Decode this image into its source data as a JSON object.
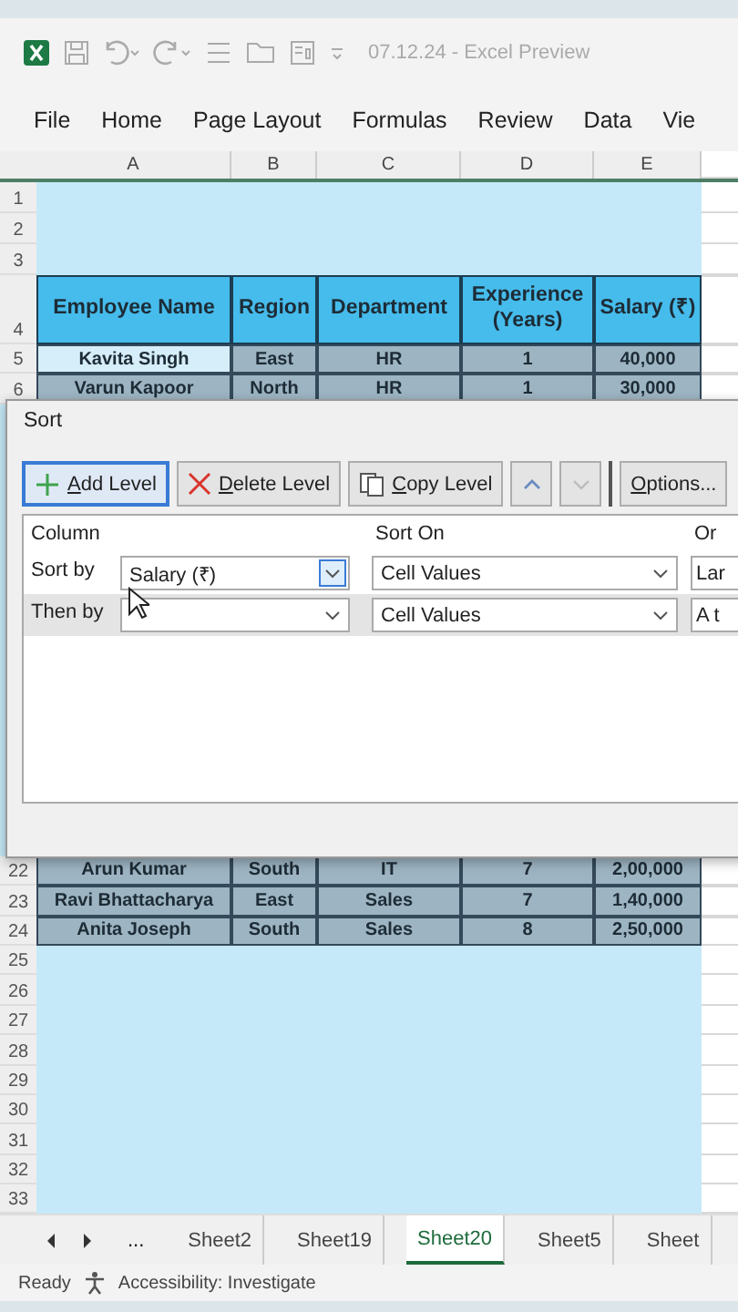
{
  "title_bar": {
    "document_title": "07.12.24  -  Excel Preview"
  },
  "ribbon_tabs": [
    {
      "label": "File"
    },
    {
      "label": "Home"
    },
    {
      "label": "Page Layout"
    },
    {
      "label": "Formulas"
    },
    {
      "label": "Review"
    },
    {
      "label": "Data"
    },
    {
      "label": "Vie"
    }
  ],
  "sheet": {
    "column_headers": [
      "A",
      "B",
      "C",
      "D",
      "E"
    ],
    "rows_top": [
      {
        "number": "1",
        "kind": "blank"
      },
      {
        "number": "2",
        "kind": "blank"
      },
      {
        "number": "3",
        "kind": "blank"
      },
      {
        "number": "4",
        "kind": "header",
        "cells": [
          {
            "text": "Employee Name"
          },
          {
            "text": "Region"
          },
          {
            "text": "Department"
          },
          {
            "text": "Experience (Years)"
          },
          {
            "text": "Salary (₹)"
          }
        ]
      },
      {
        "number": "5",
        "kind": "data",
        "cells": [
          {
            "text": "Kavita Singh",
            "selected": true
          },
          {
            "text": "East",
            "selected": false
          },
          {
            "text": "HR",
            "selected": false
          },
          {
            "text": "1",
            "selected": false
          },
          {
            "text": "40,000",
            "selected": false
          }
        ]
      },
      {
        "number": "6",
        "kind": "data",
        "cells": [
          {
            "text": "Varun Kapoor",
            "selected": false
          },
          {
            "text": "North",
            "selected": false
          },
          {
            "text": "HR",
            "selected": false
          },
          {
            "text": "1",
            "selected": false
          },
          {
            "text": "30,000",
            "selected": false
          }
        ]
      }
    ],
    "rows_bottom": [
      {
        "number": "22",
        "kind": "data",
        "cells": [
          {
            "text": "Arun Kumar",
            "selected": false
          },
          {
            "text": "South",
            "selected": false
          },
          {
            "text": "IT",
            "selected": false
          },
          {
            "text": "7",
            "selected": false
          },
          {
            "text": "2,00,000",
            "selected": false
          }
        ]
      },
      {
        "number": "23",
        "kind": "data",
        "cells": [
          {
            "text": "Ravi Bhattacharya",
            "selected": false
          },
          {
            "text": "East",
            "selected": false
          },
          {
            "text": "Sales",
            "selected": false
          },
          {
            "text": "7",
            "selected": false
          },
          {
            "text": "1,40,000",
            "selected": false
          }
        ]
      },
      {
        "number": "24",
        "kind": "data",
        "cells": [
          {
            "text": "Anita Joseph",
            "selected": false
          },
          {
            "text": "South",
            "selected": false
          },
          {
            "text": "Sales",
            "selected": false
          },
          {
            "text": "8",
            "selected": false
          },
          {
            "text": "2,50,000",
            "selected": false
          }
        ]
      },
      {
        "number": "25",
        "kind": "blank"
      },
      {
        "number": "26",
        "kind": "blank"
      },
      {
        "number": "27",
        "kind": "blank"
      },
      {
        "number": "28",
        "kind": "blank"
      },
      {
        "number": "29",
        "kind": "blank"
      },
      {
        "number": "30",
        "kind": "blank"
      },
      {
        "number": "31",
        "kind": "blank"
      },
      {
        "number": "32",
        "kind": "blank"
      },
      {
        "number": "33",
        "kind": "blank"
      }
    ]
  },
  "sort_dialog": {
    "title": "Sort",
    "toolbar": [
      {
        "kind": "add",
        "mnemonic": "A",
        "rest": "dd Level",
        "focused": true
      },
      {
        "kind": "delete",
        "mnemonic": "D",
        "rest": "elete Level",
        "focused": false
      },
      {
        "kind": "copy",
        "mnemonic": "C",
        "rest": "opy Level",
        "focused": false
      },
      {
        "kind": "up",
        "focused": false
      },
      {
        "kind": "down",
        "focused": false
      },
      {
        "kind": "options",
        "mnemonic": "O",
        "rest": "ptions...",
        "focused": false
      }
    ],
    "headers": {
      "column": "Column",
      "sort_on": "Sort On",
      "order": "Or"
    },
    "levels": [
      {
        "label": "Sort by",
        "column": "Salary (₹)",
        "column_focused": true,
        "sort_on": "Cell Values",
        "order": "Lar",
        "selected": false
      },
      {
        "label": "Then by",
        "column_focused": false,
        "sort_on": "Cell Values",
        "order": "A t",
        "selected": true
      }
    ]
  },
  "sheet_tabs": {
    "more": "...",
    "tabs": [
      {
        "label": "Sheet2",
        "selected": false
      },
      {
        "label": "Sheet19",
        "selected": false
      },
      {
        "label": "Sheet20",
        "selected": true
      },
      {
        "label": "Sheet5",
        "selected": false
      },
      {
        "label": "Sheet",
        "selected": false
      }
    ]
  },
  "status_bar": {
    "status": "Ready",
    "accessibility": "Accessibility: Investigate"
  }
}
